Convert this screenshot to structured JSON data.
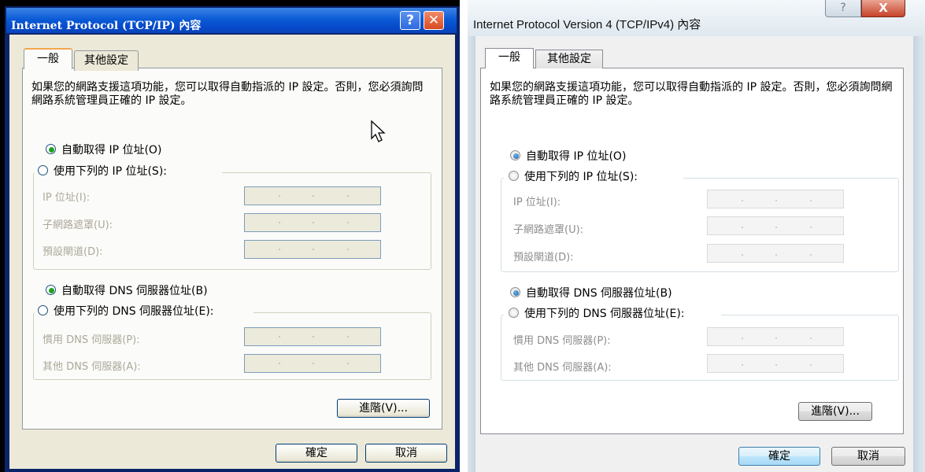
{
  "xp": {
    "title": "Internet Protocol (TCP/IP) 內容",
    "help_label": "?",
    "close_label": "✕",
    "tabs": [
      "一般",
      "其他設定"
    ],
    "description": "如果您的網路支援這項功能，您可以取得自動指派的 IP 設定。否則，您必須詢問網路系統管理員正確的 IP 設定。",
    "auto_ip": "自動取得 IP 位址(O)",
    "manual_ip": "使用下列的 IP 位址(S):",
    "ip_address": "IP 位址(I):",
    "subnet": "子網路遮罩(U):",
    "gateway": "預設閘道(D):",
    "auto_dns": "自動取得 DNS 伺服器位址(B)",
    "manual_dns": "使用下列的 DNS 伺服器位址(E):",
    "pref_dns": "慣用 DNS 伺服器(P):",
    "alt_dns": "其他 DNS 伺服器(A):",
    "advanced": "進階(V)...",
    "ok": "確定",
    "cancel": "取消"
  },
  "vista": {
    "title": "Internet Protocol Version 4 (TCP/IPv4) 內容",
    "help_label": "?",
    "close_label": "X",
    "tabs": [
      "一般",
      "其他設定"
    ],
    "description": "如果您的網路支援這項功能，您可以取得自動指派的 IP 設定。否則，您必須詢問網路系統管理員正確的 IP 設定。",
    "auto_ip": "自動取得 IP 位址(O)",
    "manual_ip": "使用下列的 IP 位址(S):",
    "ip_address": "IP 位址(I):",
    "subnet": "子網路遮罩(U):",
    "gateway": "預設閘道(D):",
    "auto_dns": "自動取得 DNS 伺服器位址(B)",
    "manual_dns": "使用下列的 DNS 伺服器位址(E):",
    "pref_dns": "慣用 DNS 伺服器(P):",
    "alt_dns": "其他 DNS 伺服器(A):",
    "advanced": "進階(V)...",
    "ok": "確定",
    "cancel": "取消"
  },
  "colors": {
    "xp_title": "#0b5bd6",
    "xp_radio_dot": "#21a121",
    "vista_radio_dot": "#1d5fa8",
    "vista_close": "#c7432a"
  }
}
